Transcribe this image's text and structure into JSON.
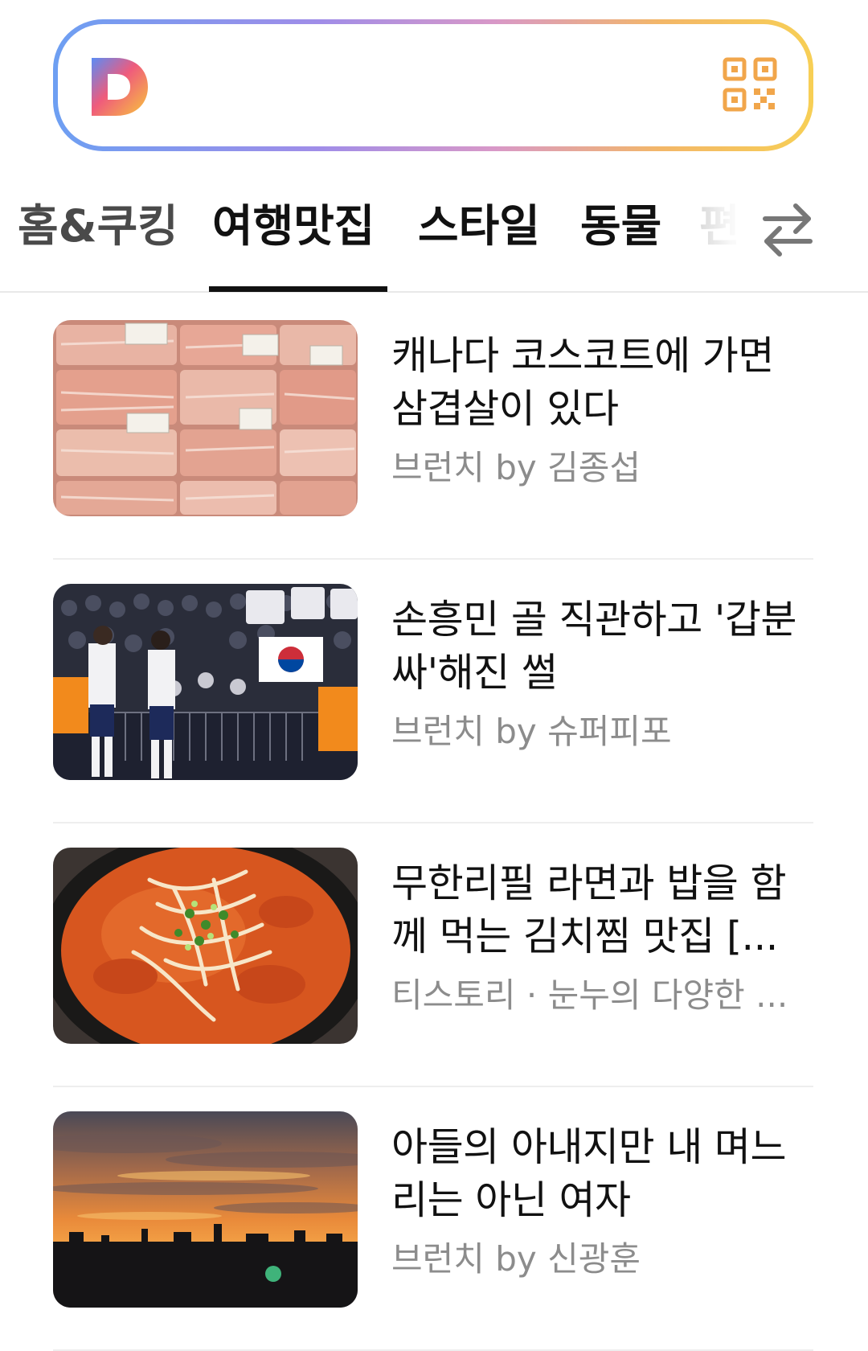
{
  "search": {
    "logo_icon": "daum-d-logo-icon",
    "qr_icon": "qr-code-icon",
    "border_gradient": [
      "#6d9ff2",
      "#a08de8",
      "#d898c8",
      "#f3b768",
      "#f7cf55"
    ]
  },
  "tabs": {
    "items": [
      {
        "label": "홈&쿠킹",
        "selected": false
      },
      {
        "label": "여행맛집",
        "selected": true
      },
      {
        "label": "스타일",
        "selected": false
      },
      {
        "label": "동물",
        "selected": false
      },
      {
        "label": "편",
        "selected": false
      }
    ],
    "swap_icon": "swap-arrows-icon"
  },
  "feed": {
    "items": [
      {
        "title": "캐나다 코스코트에 가면 삼겹살이 있다",
        "source": "브런치 by 김종섭",
        "thumbnail": "pork-belly-packages-photo"
      },
      {
        "title": "손흥민 골 직관하고 '갑분싸'해진 썰",
        "source": "브런치 by 슈퍼피포",
        "thumbnail": "football-stadium-photo"
      },
      {
        "title": "무한리필 라면과 밥을 함께 먹는 김치찜 맛집 [...",
        "source": "티스토리 · 눈누의 다양한 ...",
        "thumbnail": "kimchi-stew-photo"
      },
      {
        "title": "아들의 아내지만 내 며느리는 아닌 여자",
        "source": "브런치 by 신광훈",
        "thumbnail": "sunset-skyline-photo"
      }
    ]
  },
  "colors": {
    "text_primary": "#111111",
    "text_secondary": "#8c8c8c",
    "divider": "#eeeeee"
  }
}
